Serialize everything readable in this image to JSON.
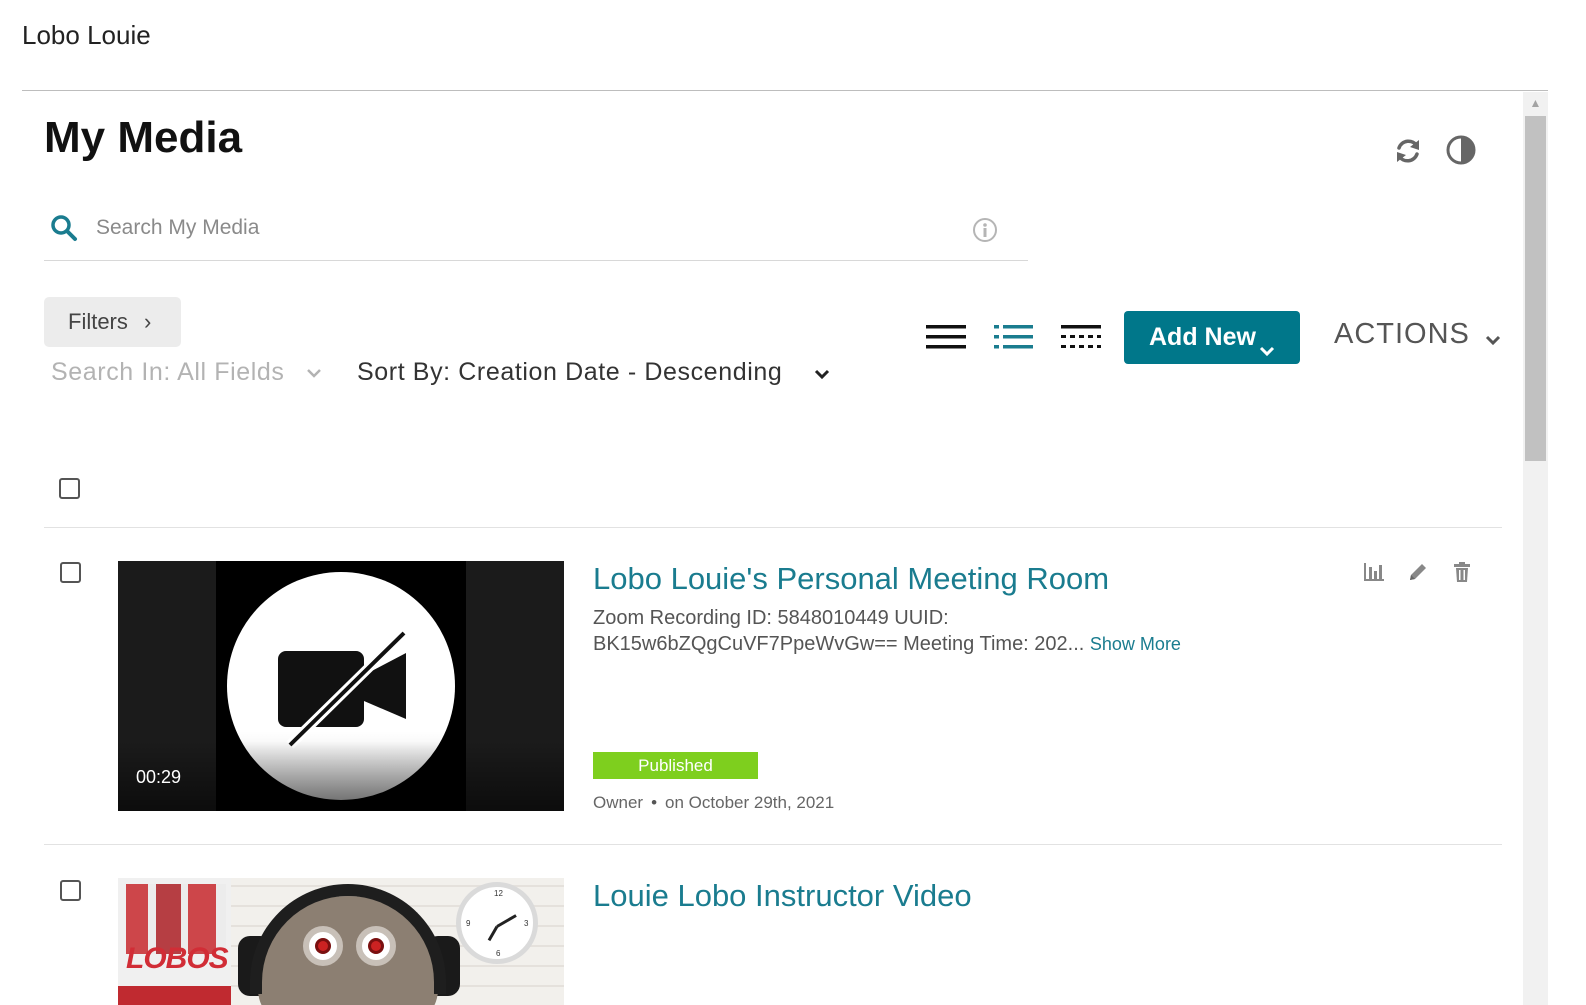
{
  "header": {
    "user_name": "Lobo Louie"
  },
  "page": {
    "title": "My Media"
  },
  "search": {
    "placeholder": "Search My Media",
    "value": ""
  },
  "toolbar": {
    "filters_label": "Filters",
    "search_in_label": "Search In: All Fields",
    "sort_by_label": "Sort By: Creation Date - Descending",
    "add_new_label": "Add New",
    "actions_label": "ACTIONS",
    "views": [
      "list-view",
      "detailed-view",
      "grid-view"
    ]
  },
  "media": [
    {
      "title": "Lobo Louie's Personal Meeting Room",
      "description": "Zoom Recording ID: 5848010449 UUID: BK15w6bZQgCuVF7PpeWvGw== Meeting Time: 202...",
      "show_more": "Show More",
      "duration": "00:29",
      "status": "Published",
      "role": "Owner",
      "date": "on October 29th, 2021"
    },
    {
      "title": "Louie Lobo Instructor Video",
      "poster_text": "LOBOS"
    }
  ],
  "colors": {
    "accent": "#00778a",
    "link": "#1a7c8f",
    "published": "#7ecf1e"
  }
}
